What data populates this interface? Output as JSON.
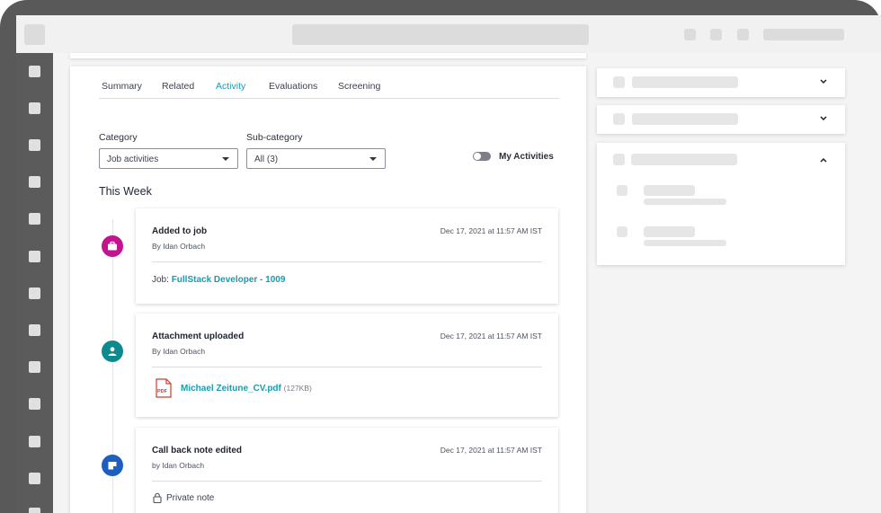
{
  "tabs": [
    {
      "label": "Summary"
    },
    {
      "label": "Related"
    },
    {
      "label": "Activity"
    },
    {
      "label": "Evaluations"
    },
    {
      "label": "Screening"
    }
  ],
  "filters": {
    "category_label": "Category",
    "category_value": "Job activities",
    "subcategory_label": "Sub-category",
    "subcategory_value": "All (3)"
  },
  "toggle": {
    "label": "My Activities",
    "on": false
  },
  "section_title": "This Week",
  "activities": [
    {
      "title": "Added to job",
      "by": "By Idan Orbach",
      "date": "Dec 17, 2021 at 11:57 AM IST",
      "job_prefix": "Job: ",
      "job_link": "FullStack Developer - 1009",
      "icon": "briefcase-icon",
      "color": "#c3138f"
    },
    {
      "title": "Attachment uploaded",
      "by": "By Idan Orbach",
      "date": "Dec 17, 2021 at 11:57 AM IST",
      "file_name": "Michael Zeitune_CV.pdf",
      "file_size": "(127KB)",
      "file_badge": "PDF",
      "icon": "person-icon",
      "color": "#0e8a8f"
    },
    {
      "title": "Call back note edited",
      "by": "by Idan Orbach",
      "date": "Dec 17, 2021 at 11:57 AM IST",
      "note": "Private note",
      "icon": "note-icon",
      "color": "#1c5fbf"
    }
  ],
  "colors": {
    "accent": "#1a9bb0",
    "pdf": "#d33a2c"
  }
}
